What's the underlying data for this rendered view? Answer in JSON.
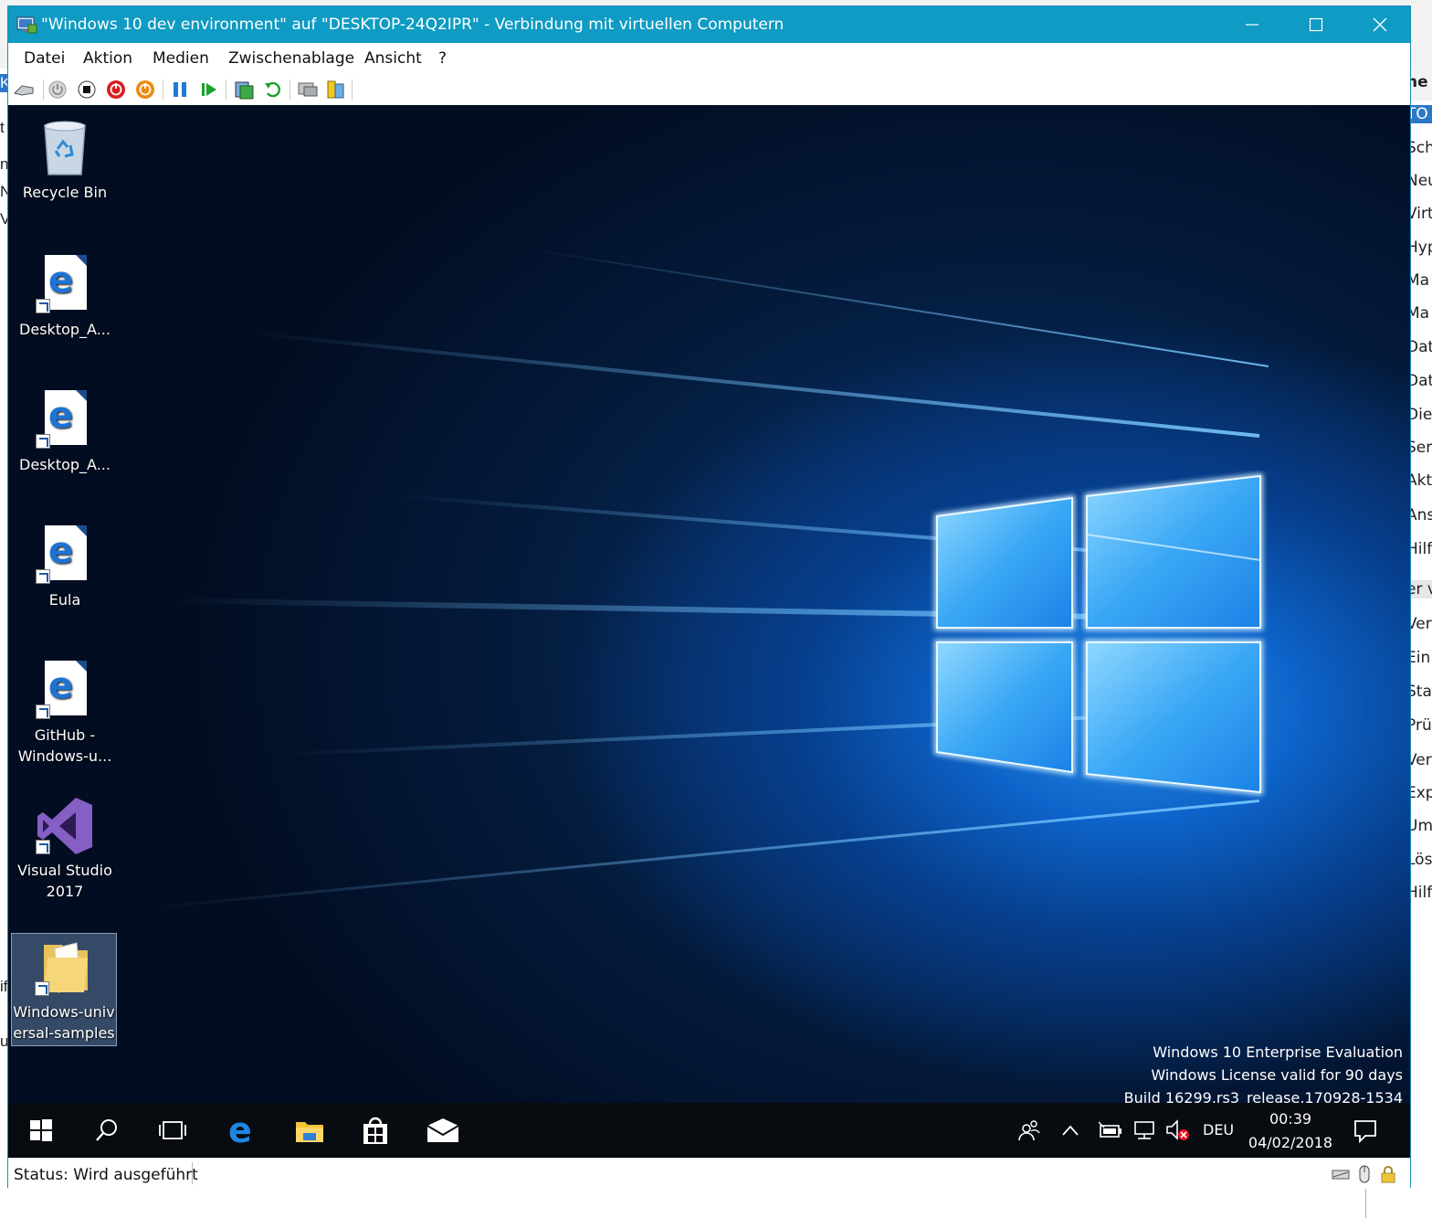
{
  "window": {
    "title": "\"Windows 10 dev environment\" auf \"DESKTOP-24Q2IPR\" - Verbindung mit virtuellen Computern"
  },
  "menu": [
    "Datei",
    "Aktion",
    "Medien",
    "Zwischenablage",
    "Ansicht",
    "?"
  ],
  "desktop": {
    "icons": [
      {
        "label": "Recycle Bin"
      },
      {
        "label": "Desktop_A..."
      },
      {
        "label": "Desktop_A..."
      },
      {
        "label": "Eula"
      },
      {
        "label": "GitHub - Windows-u..."
      },
      {
        "label": "Visual Studio 2017"
      },
      {
        "label": "Windows-universal-samples"
      }
    ],
    "watermark": [
      "Windows 10 Enterprise Evaluation",
      "Windows License valid for 90 days",
      "Build 16299.rs3_release.170928-1534"
    ]
  },
  "taskbar": {
    "language": "DEU",
    "time": "00:39",
    "date": "04/02/2018"
  },
  "status": {
    "text": "Status: Wird ausgeführt"
  },
  "background_app": {
    "right_items": [
      "ne",
      "TO",
      "Sch",
      "Neu",
      "Virt",
      "Hyp",
      "Ma",
      "Ma",
      "Dat",
      "Dat",
      "Die",
      "Ser",
      "Akt",
      "Ans",
      "Hilf",
      "er v",
      "Ver",
      "Ein",
      "Sta",
      "Prü",
      "Ver",
      "Exp",
      "Um",
      "Lös",
      "Hilf"
    ],
    "left_items": [
      "K",
      "t",
      "n",
      "N",
      "V",
      "if",
      "u"
    ]
  },
  "colors": {
    "titlebar": "#0f9bc3",
    "taskbar": "#080b10",
    "selection": "#2b78c8"
  }
}
